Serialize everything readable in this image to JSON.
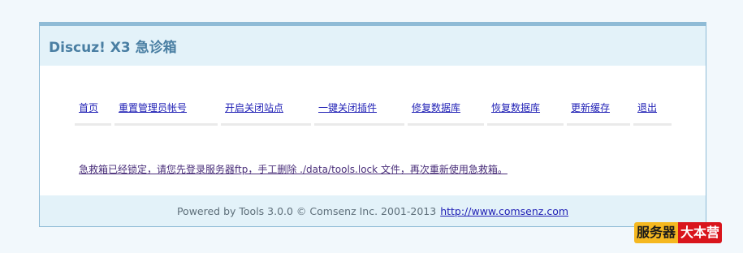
{
  "header": {
    "title": "Discuz! X3 急诊箱"
  },
  "nav": {
    "items": [
      {
        "label": "首页",
        "name": "nav-item-home"
      },
      {
        "label": "重置管理员帐号",
        "name": "nav-item-reset-admin"
      },
      {
        "label": "开启关闭站点",
        "name": "nav-item-toggle-site"
      },
      {
        "label": "一键关闭插件",
        "name": "nav-item-close-plugins"
      },
      {
        "label": "修复数据库",
        "name": "nav-item-repair-db"
      },
      {
        "label": "恢复数据库",
        "name": "nav-item-restore-db"
      },
      {
        "label": "更新缓存",
        "name": "nav-item-update-cache"
      },
      {
        "label": "退出",
        "name": "nav-item-logout"
      }
    ]
  },
  "notice": {
    "text": "急救箱已经锁定，请您先登录服务器ftp，手工删除 ./data/tools.lock 文件，再次重新使用急救箱。"
  },
  "footer": {
    "text": "Powered by Tools 3.0.0 © Comsenz Inc. 2001-2013",
    "link": "http://www.comsenz.com"
  },
  "watermark": {
    "part1": "服务器",
    "part2": "大本营"
  },
  "colors": {
    "page_bg": "#f2f8fc",
    "panel_border": "#8fbbd6",
    "header_bg": "#e3f2f9",
    "title": "#4a7fa3",
    "link": "#1f1fb5"
  }
}
